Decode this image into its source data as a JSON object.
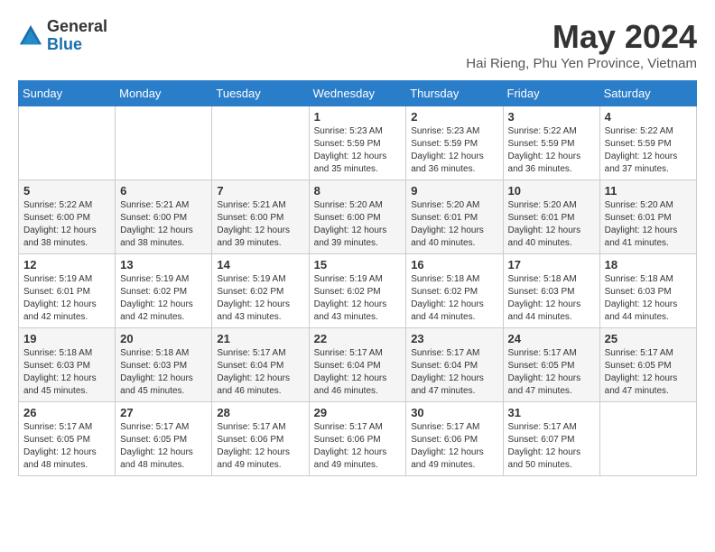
{
  "logo": {
    "general": "General",
    "blue": "Blue"
  },
  "title": {
    "month_year": "May 2024",
    "location": "Hai Rieng, Phu Yen Province, Vietnam"
  },
  "days_of_week": [
    "Sunday",
    "Monday",
    "Tuesday",
    "Wednesday",
    "Thursday",
    "Friday",
    "Saturday"
  ],
  "weeks": [
    [
      {
        "day": "",
        "info": ""
      },
      {
        "day": "",
        "info": ""
      },
      {
        "day": "",
        "info": ""
      },
      {
        "day": "1",
        "info": "Sunrise: 5:23 AM\nSunset: 5:59 PM\nDaylight: 12 hours\nand 35 minutes."
      },
      {
        "day": "2",
        "info": "Sunrise: 5:23 AM\nSunset: 5:59 PM\nDaylight: 12 hours\nand 36 minutes."
      },
      {
        "day": "3",
        "info": "Sunrise: 5:22 AM\nSunset: 5:59 PM\nDaylight: 12 hours\nand 36 minutes."
      },
      {
        "day": "4",
        "info": "Sunrise: 5:22 AM\nSunset: 5:59 PM\nDaylight: 12 hours\nand 37 minutes."
      }
    ],
    [
      {
        "day": "5",
        "info": "Sunrise: 5:22 AM\nSunset: 6:00 PM\nDaylight: 12 hours\nand 38 minutes."
      },
      {
        "day": "6",
        "info": "Sunrise: 5:21 AM\nSunset: 6:00 PM\nDaylight: 12 hours\nand 38 minutes."
      },
      {
        "day": "7",
        "info": "Sunrise: 5:21 AM\nSunset: 6:00 PM\nDaylight: 12 hours\nand 39 minutes."
      },
      {
        "day": "8",
        "info": "Sunrise: 5:20 AM\nSunset: 6:00 PM\nDaylight: 12 hours\nand 39 minutes."
      },
      {
        "day": "9",
        "info": "Sunrise: 5:20 AM\nSunset: 6:01 PM\nDaylight: 12 hours\nand 40 minutes."
      },
      {
        "day": "10",
        "info": "Sunrise: 5:20 AM\nSunset: 6:01 PM\nDaylight: 12 hours\nand 40 minutes."
      },
      {
        "day": "11",
        "info": "Sunrise: 5:20 AM\nSunset: 6:01 PM\nDaylight: 12 hours\nand 41 minutes."
      }
    ],
    [
      {
        "day": "12",
        "info": "Sunrise: 5:19 AM\nSunset: 6:01 PM\nDaylight: 12 hours\nand 42 minutes."
      },
      {
        "day": "13",
        "info": "Sunrise: 5:19 AM\nSunset: 6:02 PM\nDaylight: 12 hours\nand 42 minutes."
      },
      {
        "day": "14",
        "info": "Sunrise: 5:19 AM\nSunset: 6:02 PM\nDaylight: 12 hours\nand 43 minutes."
      },
      {
        "day": "15",
        "info": "Sunrise: 5:19 AM\nSunset: 6:02 PM\nDaylight: 12 hours\nand 43 minutes."
      },
      {
        "day": "16",
        "info": "Sunrise: 5:18 AM\nSunset: 6:02 PM\nDaylight: 12 hours\nand 44 minutes."
      },
      {
        "day": "17",
        "info": "Sunrise: 5:18 AM\nSunset: 6:03 PM\nDaylight: 12 hours\nand 44 minutes."
      },
      {
        "day": "18",
        "info": "Sunrise: 5:18 AM\nSunset: 6:03 PM\nDaylight: 12 hours\nand 44 minutes."
      }
    ],
    [
      {
        "day": "19",
        "info": "Sunrise: 5:18 AM\nSunset: 6:03 PM\nDaylight: 12 hours\nand 45 minutes."
      },
      {
        "day": "20",
        "info": "Sunrise: 5:18 AM\nSunset: 6:03 PM\nDaylight: 12 hours\nand 45 minutes."
      },
      {
        "day": "21",
        "info": "Sunrise: 5:17 AM\nSunset: 6:04 PM\nDaylight: 12 hours\nand 46 minutes."
      },
      {
        "day": "22",
        "info": "Sunrise: 5:17 AM\nSunset: 6:04 PM\nDaylight: 12 hours\nand 46 minutes."
      },
      {
        "day": "23",
        "info": "Sunrise: 5:17 AM\nSunset: 6:04 PM\nDaylight: 12 hours\nand 47 minutes."
      },
      {
        "day": "24",
        "info": "Sunrise: 5:17 AM\nSunset: 6:05 PM\nDaylight: 12 hours\nand 47 minutes."
      },
      {
        "day": "25",
        "info": "Sunrise: 5:17 AM\nSunset: 6:05 PM\nDaylight: 12 hours\nand 47 minutes."
      }
    ],
    [
      {
        "day": "26",
        "info": "Sunrise: 5:17 AM\nSunset: 6:05 PM\nDaylight: 12 hours\nand 48 minutes."
      },
      {
        "day": "27",
        "info": "Sunrise: 5:17 AM\nSunset: 6:05 PM\nDaylight: 12 hours\nand 48 minutes."
      },
      {
        "day": "28",
        "info": "Sunrise: 5:17 AM\nSunset: 6:06 PM\nDaylight: 12 hours\nand 49 minutes."
      },
      {
        "day": "29",
        "info": "Sunrise: 5:17 AM\nSunset: 6:06 PM\nDaylight: 12 hours\nand 49 minutes."
      },
      {
        "day": "30",
        "info": "Sunrise: 5:17 AM\nSunset: 6:06 PM\nDaylight: 12 hours\nand 49 minutes."
      },
      {
        "day": "31",
        "info": "Sunrise: 5:17 AM\nSunset: 6:07 PM\nDaylight: 12 hours\nand 50 minutes."
      },
      {
        "day": "",
        "info": ""
      }
    ]
  ]
}
